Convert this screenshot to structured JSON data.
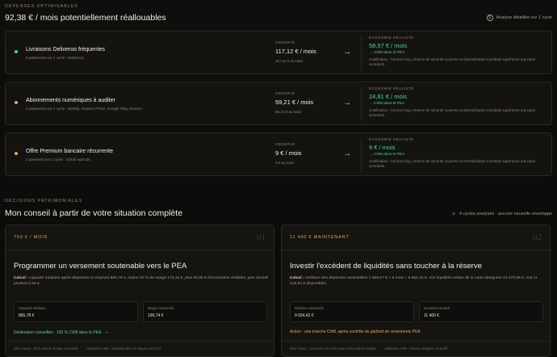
{
  "optim": {
    "label": "DÉPENSES OPTIMISABLES",
    "title": "92,38 € / mois potentiellement réallouables",
    "note": "Analyse détaillée sur 1 cycle",
    "note_icon": "dollar-circle-icon"
  },
  "cards": [
    {
      "dot_color": "#4fd494",
      "title": "Livraisons Deliveroo fréquentes",
      "sub": "8 paiements sur 1 cycle : Deliveroo.",
      "obs_label": "OBSERVÉ",
      "obs_value": "117,12 € / mois",
      "obs_total": "117,12 € au total",
      "eco_label": "ÉCONOMIE RÉALISTE",
      "eco_value": "58,57 € / mois",
      "eco_pea": "→ CW8 dans le PEA",
      "eco_just": "Justification : horizon long, réserve de sécurité couverte et diversification mondiale supérieure aux paris sectoriels."
    },
    {
      "dot_color": "#e0a85a",
      "title": "Abonnements numériques à auditer",
      "sub": "4 paiements sur 1 cycle : Spotify, Amazon Prime, Google Play, Disney+.",
      "obs_label": "OBSERVÉ",
      "obs_value": "59,21 € / mois",
      "obs_total": "59,21 € au total",
      "eco_label": "ÉCONOMIE RÉALISTE",
      "eco_value": "24,81 € / mois",
      "eco_pea": "→ CW8 dans le PEA",
      "eco_just": "Justification : horizon long, réserve de sécurité couverte et diversification mondiale supérieure aux paris sectoriels."
    },
    {
      "dot_color": "#e0a85a",
      "title": "Offre Premium bancaire récurrente",
      "sub": "1 paiement sur 1 cycle : Crédit Agricole.",
      "obs_label": "OBSERVÉ",
      "obs_value": "9 € / mois",
      "obs_total": "9 € au total",
      "eco_label": "ÉCONOMIE RÉALISTE",
      "eco_value": "9 € / mois",
      "eco_pea": "→ CW8 dans le PEA",
      "eco_just": "Justification : horizon long, réserve de sécurité couverte et diversification mondiale supérieure aux paris sectoriels."
    }
  ],
  "decisions": {
    "label": "DÉCISIONS PATRIMONIALES",
    "title": "Mon conseil à partir de votre situation complète",
    "note": "4 cycles analysés · aucune nouvelle enveloppe",
    "note_icon": "sparkle-icon"
  },
  "plans": [
    {
      "tag": "750 € / MOIS",
      "num": "01",
      "title": "Programmer un versement soutenable vers le PEA",
      "calc_bold": "Calcul :",
      "calc": " capacité médiane après dépenses et emprunt 865,78 €, moins 20 % de marge 173,16 €, plus 83,96 € d'économies réalistes, puis arrondi prudent à 50 €.",
      "box1_label": "Capacité médiane",
      "box1_value": "865,78 €",
      "box2_label": "Marge conservée",
      "box2_value": "199,74 €",
      "action": "Destination conseillée : 100 % CW8 dans le PEA",
      "action_color": "#4fd494",
      "foot1": "Idée Finary : DCA Monde simple et durable",
      "foot2": "Validation AMF : diversification et risques des ETF"
    },
    {
      "tag": "11 400 € MAINTENANT",
      "num": "02",
      "title": "Investir l'excédent de liquidités sans toucher à la réserve",
      "calc_bold": "Calcul :",
      "calc": " médiane des dépenses essentielles 1 609,07 € × 6 mois = 9 654,42 €. Vos liquidités nettes de la carte atteignent 21 070,06 €, soit 11 415,64 € disponibles.",
      "box1_label": "Réserve conservée",
      "box1_value": "9 654,42 €",
      "box2_label": "Excédent arrondi",
      "box2_value": "11 400 €",
      "action": "Action : une tranche CW8, après contrôle du plafond de versements PEA",
      "action_color": "#e0a85a",
      "foot1": "Idée Finary : conserver les mois avant d'investir le surplus",
      "foot2": "Validation AMF : réserve adaptée au profil"
    }
  ]
}
